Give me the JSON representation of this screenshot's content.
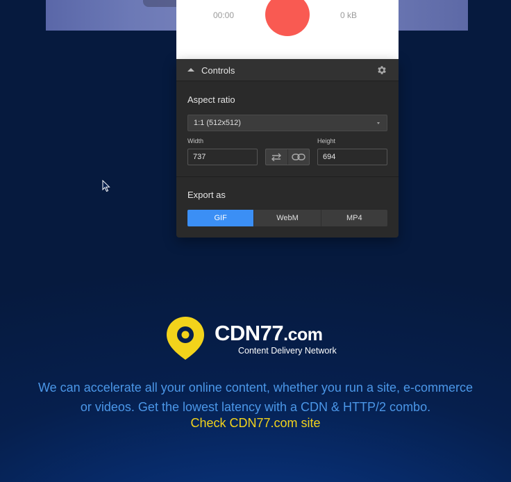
{
  "recorder": {
    "time": "00:00",
    "size": "0 kB"
  },
  "controls": {
    "title": "Controls",
    "aspect_ratio_label": "Aspect ratio",
    "aspect_ratio_value": "1:1 (512x512)",
    "width_label": "Width",
    "width_value": "737",
    "height_label": "Height",
    "height_value": "694",
    "export_label": "Export as",
    "export_options": [
      "GIF",
      "WebM",
      "MP4"
    ],
    "export_selected": "GIF"
  },
  "brand": {
    "name": "CDN77",
    "name_suffix": ".com",
    "tagline": "Content Delivery Network",
    "promo_line1": "We can accelerate all your online content, whether you run a site, e-commerce",
    "promo_line2": "or videos. Get the lowest latency with a CDN & HTTP/2 combo.",
    "link": "Check CDN77.com site"
  },
  "colors": {
    "accent_blue": "#3b8ff5",
    "record_red": "#f95a52",
    "brand_yellow": "#f2d31b",
    "promo_blue": "#4b97e8"
  }
}
